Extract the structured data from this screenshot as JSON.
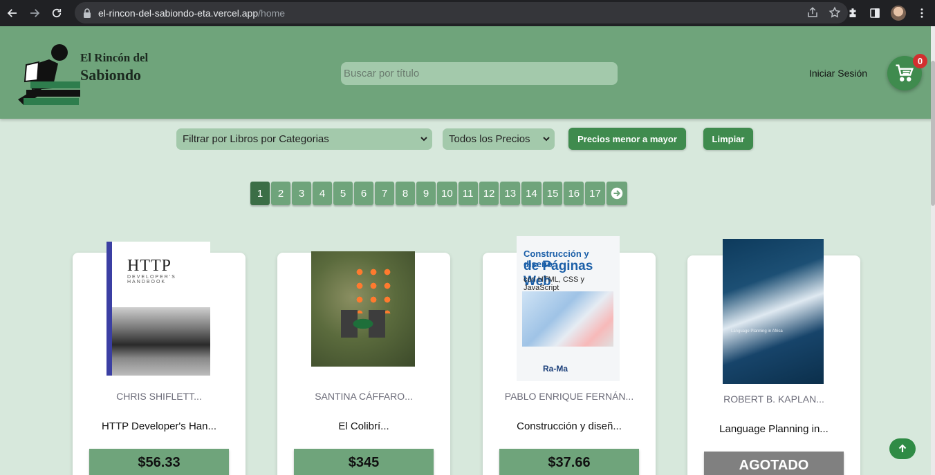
{
  "browser": {
    "url_host": "el-rincon-del-sabiondo-eta.vercel.app",
    "url_path": "/home"
  },
  "header": {
    "logo_line1": "El Rincón del",
    "logo_line2": "Sabiondo",
    "search_placeholder": "Buscar por título",
    "login_label": "Iniciar Sesión",
    "cart_count": "0"
  },
  "filters": {
    "category_select": "Filtrar por Libros por Categorias",
    "price_select": "Todos los Precios",
    "sort_button": "Precios menor a mayor",
    "clear_button": "Limpiar"
  },
  "pagination": {
    "pages": [
      "1",
      "2",
      "3",
      "4",
      "5",
      "6",
      "7",
      "8",
      "9",
      "10",
      "11",
      "12",
      "13",
      "14",
      "15",
      "16",
      "17"
    ],
    "active_page": "1"
  },
  "books": [
    {
      "author": "CHRIS SHIFLETT...",
      "title": "HTTP Developer's Han...",
      "price": "$56.33",
      "cover_title": "HTTP",
      "cover_subtitle": "DEVELOPER'S HANDBOOK"
    },
    {
      "author": "SANTINA CÁFFARO...",
      "title": "El Colibrí...",
      "price": "$345"
    },
    {
      "author": "PABLO ENRIQUE FERNÁN...",
      "title": "Construcción y diseñ...",
      "price": "$37.66",
      "cover_line1": "Construcción y diseño",
      "cover_line2": "de Páginas Web",
      "cover_line3": "con HTML, CSS y JavaScript",
      "cover_publisher": "Ra-Ma"
    },
    {
      "author": "ROBERT B. KAPLAN...",
      "title": "Language Planning in...",
      "price": "AGOTADO",
      "cover_text": "Language Planning in Africa"
    }
  ],
  "colors": {
    "header_bg": "#6fa47b",
    "page_bg": "#d7e8dc",
    "accent_green": "#3f8b4e",
    "sold_out": "#808080"
  }
}
